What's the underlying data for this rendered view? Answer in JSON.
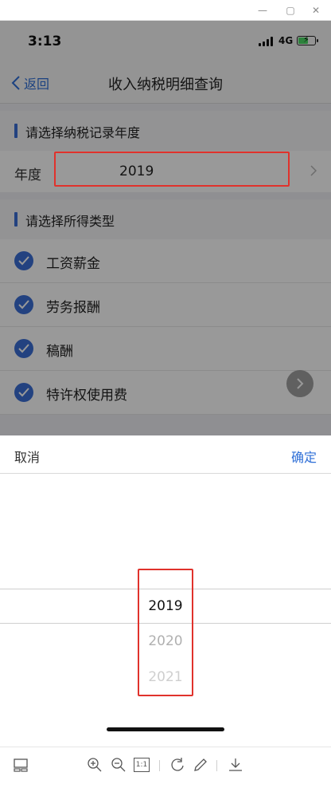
{
  "status_bar": {
    "time": "3:13",
    "network": "4G"
  },
  "nav": {
    "back_label": "返回",
    "title": "收入纳税明细查询"
  },
  "year_section": {
    "heading": "请选择纳税记录年度",
    "label": "年度",
    "value": "2019"
  },
  "type_section": {
    "heading": "请选择所得类型",
    "items": [
      {
        "label": "工资薪金",
        "checked": true
      },
      {
        "label": "劳务报酬",
        "checked": true
      },
      {
        "label": "稿酬",
        "checked": true
      },
      {
        "label": "特许权使用费",
        "checked": true
      }
    ]
  },
  "picker": {
    "cancel_label": "取消",
    "confirm_label": "确定",
    "options": [
      "2019",
      "2020",
      "2021"
    ],
    "selected": "2019"
  },
  "viewer_toolbar": {
    "zoom_actual_label": "1:1"
  },
  "colors": {
    "accent": "#2f6fd7",
    "check": "#3b6fd6",
    "highlight": "#e0322c"
  }
}
